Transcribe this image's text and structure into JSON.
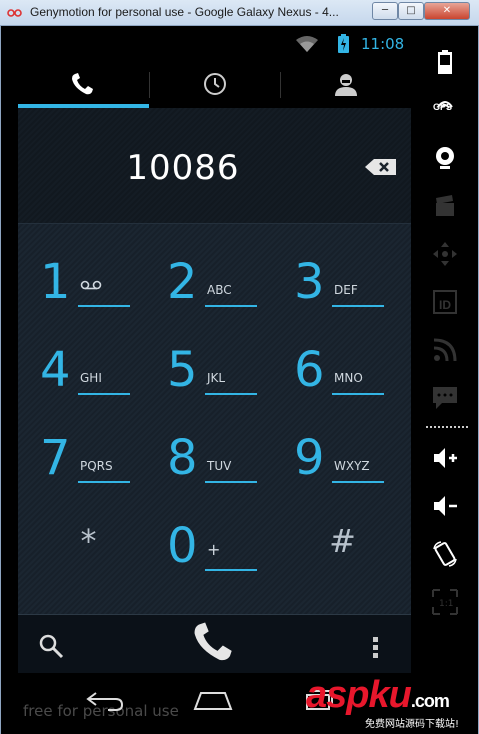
{
  "window": {
    "title": "Genymotion for personal use - Google Galaxy Nexus - 4..."
  },
  "window_controls": {
    "minimize": "─",
    "maximize": "□",
    "close": "✕"
  },
  "status": {
    "time": "11:08"
  },
  "tabs": [
    {
      "name": "phone",
      "icon": "phone-icon",
      "active": true
    },
    {
      "name": "call-log",
      "icon": "clock-icon",
      "active": false
    },
    {
      "name": "contacts",
      "icon": "person-icon",
      "active": false
    }
  ],
  "dialer": {
    "number": "10086",
    "keys": [
      {
        "num": "1",
        "letters": ""
      },
      {
        "num": "2",
        "letters": "ABC"
      },
      {
        "num": "3",
        "letters": "DEF"
      },
      {
        "num": "4",
        "letters": "GHI"
      },
      {
        "num": "5",
        "letters": "JKL"
      },
      {
        "num": "6",
        "letters": "MNO"
      },
      {
        "num": "7",
        "letters": "PQRS"
      },
      {
        "num": "8",
        "letters": "TUV"
      },
      {
        "num": "9",
        "letters": "WXYZ"
      },
      {
        "num": "*",
        "letters": ""
      },
      {
        "num": "0",
        "letters": "+"
      },
      {
        "num": "#",
        "letters": ""
      }
    ]
  },
  "footer": {
    "watermark": "free for personal use"
  },
  "sidebar": {
    "gps": "GPS",
    "id": "ID"
  },
  "brand": {
    "name": "aspku",
    "tld": ".com",
    "subtitle": "免费网站源码下载站!"
  },
  "colors": {
    "accent": "#33b5e5",
    "brand": "#e8172c"
  }
}
